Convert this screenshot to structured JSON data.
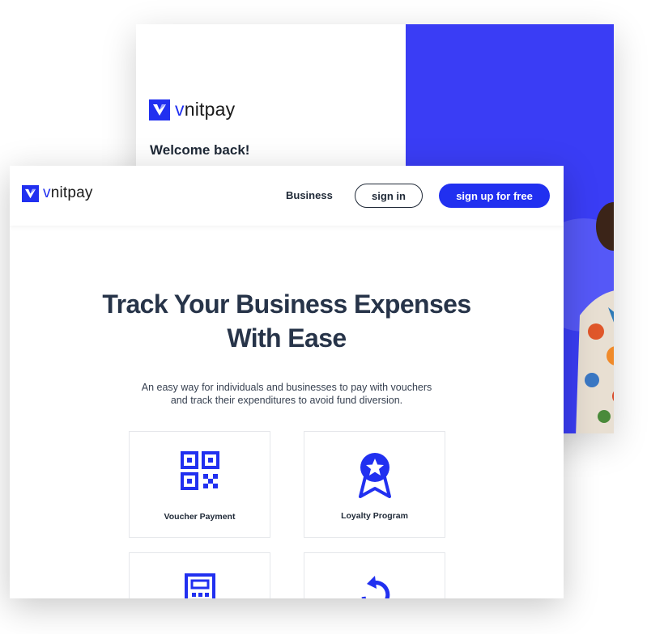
{
  "brand": {
    "prefix": "v",
    "name": "nitpay",
    "color": "#2130f0"
  },
  "login_screen": {
    "welcome": "Welcome back!",
    "accent_color": "#3a3df5"
  },
  "nav": {
    "business": "Business",
    "sign_in": "sign in",
    "sign_up": "sign up for free"
  },
  "hero": {
    "title_line1": "Track Your Business Expenses",
    "title_line2": "With Ease",
    "subtitle_line1": "An easy way for individuals and businesses to pay with vouchers",
    "subtitle_line2": "and track their expenditures to avoid fund diversion."
  },
  "features": [
    {
      "label": "Voucher Payment",
      "icon": "qr-code-icon"
    },
    {
      "label": "Loyalty Program",
      "icon": "badge-star-icon"
    },
    {
      "label": "",
      "icon": "calculator-icon"
    },
    {
      "label": "",
      "icon": "refresh-icon"
    }
  ]
}
